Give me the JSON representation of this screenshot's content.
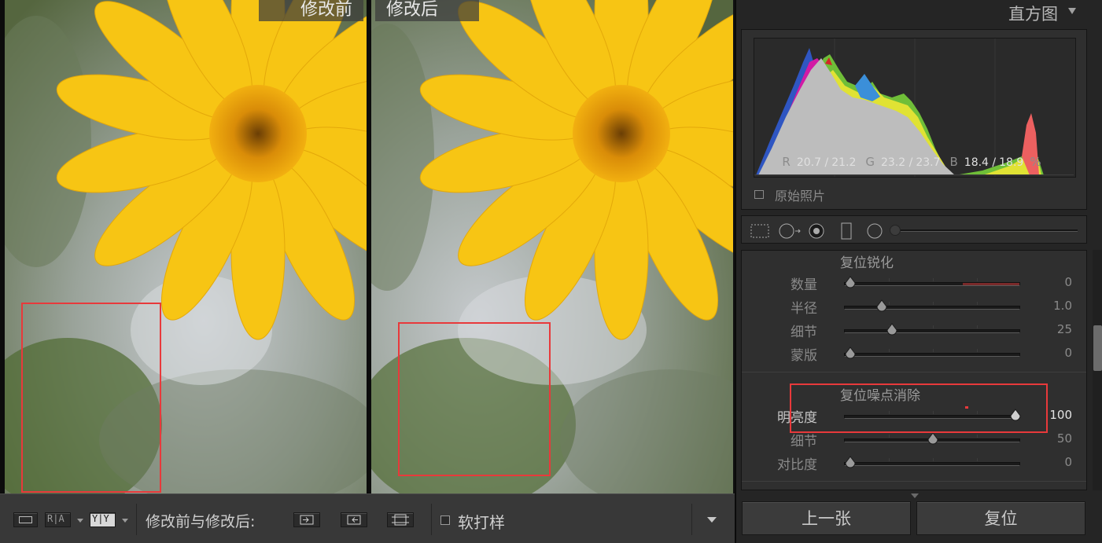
{
  "viewer": {
    "before_label": "修改前",
    "after_label": "修改后"
  },
  "toolbar": {
    "compare_label": "修改前与修改后:",
    "ra_label": "R|A",
    "yy_label": "Y|Y",
    "soft_proof_label": "软打样"
  },
  "histogram": {
    "title": "直方图",
    "rgb": {
      "r_label": "R",
      "r_before": "20.7 /",
      "r_after": "21.2",
      "g_label": "G",
      "g_before": "23.2 /",
      "g_after": "23.7",
      "b_label": "B",
      "b_before": "18.4 /",
      "b_after": "18.9",
      "unit": "%"
    },
    "original_photo_label": "原始照片"
  },
  "sharpening": {
    "title": "复位锐化",
    "sliders": [
      {
        "label": "数量",
        "value": "0",
        "fraction": 0.0
      },
      {
        "label": "半径",
        "value": "1.0",
        "fraction": 0.19
      },
      {
        "label": "细节",
        "value": "25",
        "fraction": 0.25
      },
      {
        "label": "蒙版",
        "value": "0",
        "fraction": 0.0
      }
    ]
  },
  "noise_reduction": {
    "title": "复位噪点消除",
    "sliders": [
      {
        "label": "明亮度",
        "value": "100",
        "fraction": 1.0
      },
      {
        "label": "细节",
        "value": "50",
        "fraction": 0.5
      },
      {
        "label": "对比度",
        "value": "0",
        "fraction": 0.0
      }
    ]
  },
  "nav": {
    "prev_label": "上一张",
    "reset_label": "复位"
  },
  "colors": {
    "highlight_box": "#e8393b",
    "panel_bg": "#2f2f2f",
    "petal_yellow": "#f7c514"
  }
}
